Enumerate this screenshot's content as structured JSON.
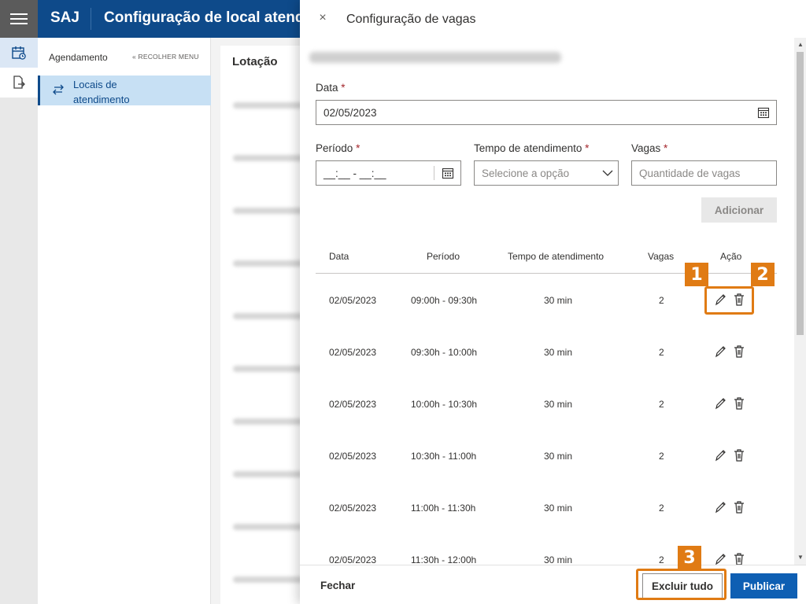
{
  "topbar": {
    "brand": "SAJ",
    "title": "Configuração de local atendimento"
  },
  "submenu": {
    "heading": "Agendamento",
    "collapse_label": "« RECOLHER MENU",
    "active_item": "Locais de atendimento"
  },
  "background": {
    "tab_label": "Lotação"
  },
  "panel": {
    "title": "Configuração de vagas",
    "close_glyph": "×",
    "date_label": "Data",
    "date_value": "02/05/2023",
    "period_label": "Período",
    "period_mask": "__:__ - __:__",
    "tempo_label": "Tempo de atendimento",
    "tempo_placeholder": "Selecione a opção",
    "vagas_label": "Vagas",
    "vagas_placeholder": "Quantidade de vagas",
    "required_mark": "*",
    "add_button": "Adicionar",
    "table": {
      "headers": [
        "Data",
        "Período",
        "Tempo de atendimento",
        "Vagas",
        "Ação"
      ],
      "rows": [
        {
          "data": "02/05/2023",
          "periodo": "09:00h - 09:30h",
          "tempo": "30 min",
          "vagas": "2"
        },
        {
          "data": "02/05/2023",
          "periodo": "09:30h - 10:00h",
          "tempo": "30 min",
          "vagas": "2"
        },
        {
          "data": "02/05/2023",
          "periodo": "10:00h - 10:30h",
          "tempo": "30 min",
          "vagas": "2"
        },
        {
          "data": "02/05/2023",
          "periodo": "10:30h - 11:00h",
          "tempo": "30 min",
          "vagas": "2"
        },
        {
          "data": "02/05/2023",
          "periodo": "11:00h - 11:30h",
          "tempo": "30 min",
          "vagas": "2"
        },
        {
          "data": "02/05/2023",
          "periodo": "11:30h - 12:00h",
          "tempo": "30 min",
          "vagas": "2"
        }
      ]
    },
    "footer": {
      "close": "Fechar",
      "delete_all": "Excluir tudo",
      "publish": "Publicar"
    }
  },
  "callouts": [
    "1",
    "2",
    "3"
  ],
  "colors": {
    "brand": "#0e4a8a",
    "primary": "#0e5fb3",
    "callout": "#e07b14",
    "required": "#a4262c"
  }
}
